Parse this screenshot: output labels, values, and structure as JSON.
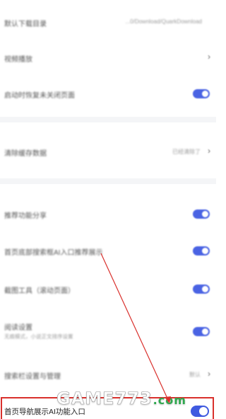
{
  "settings": {
    "rows": [
      {
        "label": "默认下载目录",
        "value": "...0/Download/QuarkDownload",
        "control": "value"
      },
      {
        "label": "视频播放",
        "control": "chevron"
      },
      {
        "label": "启动时恢复未关闭页面",
        "control": "toggle",
        "on": true
      },
      {
        "label": "清除缓存数据",
        "value": "已经清除了",
        "control": "chevron"
      },
      {
        "label": "推荐功能分享",
        "control": "toggle",
        "on": true
      },
      {
        "label": "首页底部搜索框AI入口推荐展示",
        "control": "toggle",
        "on": true
      },
      {
        "label": "截图工具（滚动页面）",
        "control": "toggle",
        "on": true
      },
      {
        "label": "阅读设置",
        "sub": "无痕模式，小说正文排序设置",
        "control": "toggle",
        "on": true
      },
      {
        "label": "搜索栏设置与管理",
        "value": "默认",
        "control": "chevron"
      }
    ],
    "highlighted_row": {
      "label": "首页导航展示AI功能入口",
      "on": true
    }
  },
  "watermark": {
    "main": "GAME773",
    "tld": ".com"
  },
  "colors": {
    "toggle_on": "#4a63e3",
    "highlight": "#d9302c",
    "watermark_tld": "#2fa84f"
  }
}
